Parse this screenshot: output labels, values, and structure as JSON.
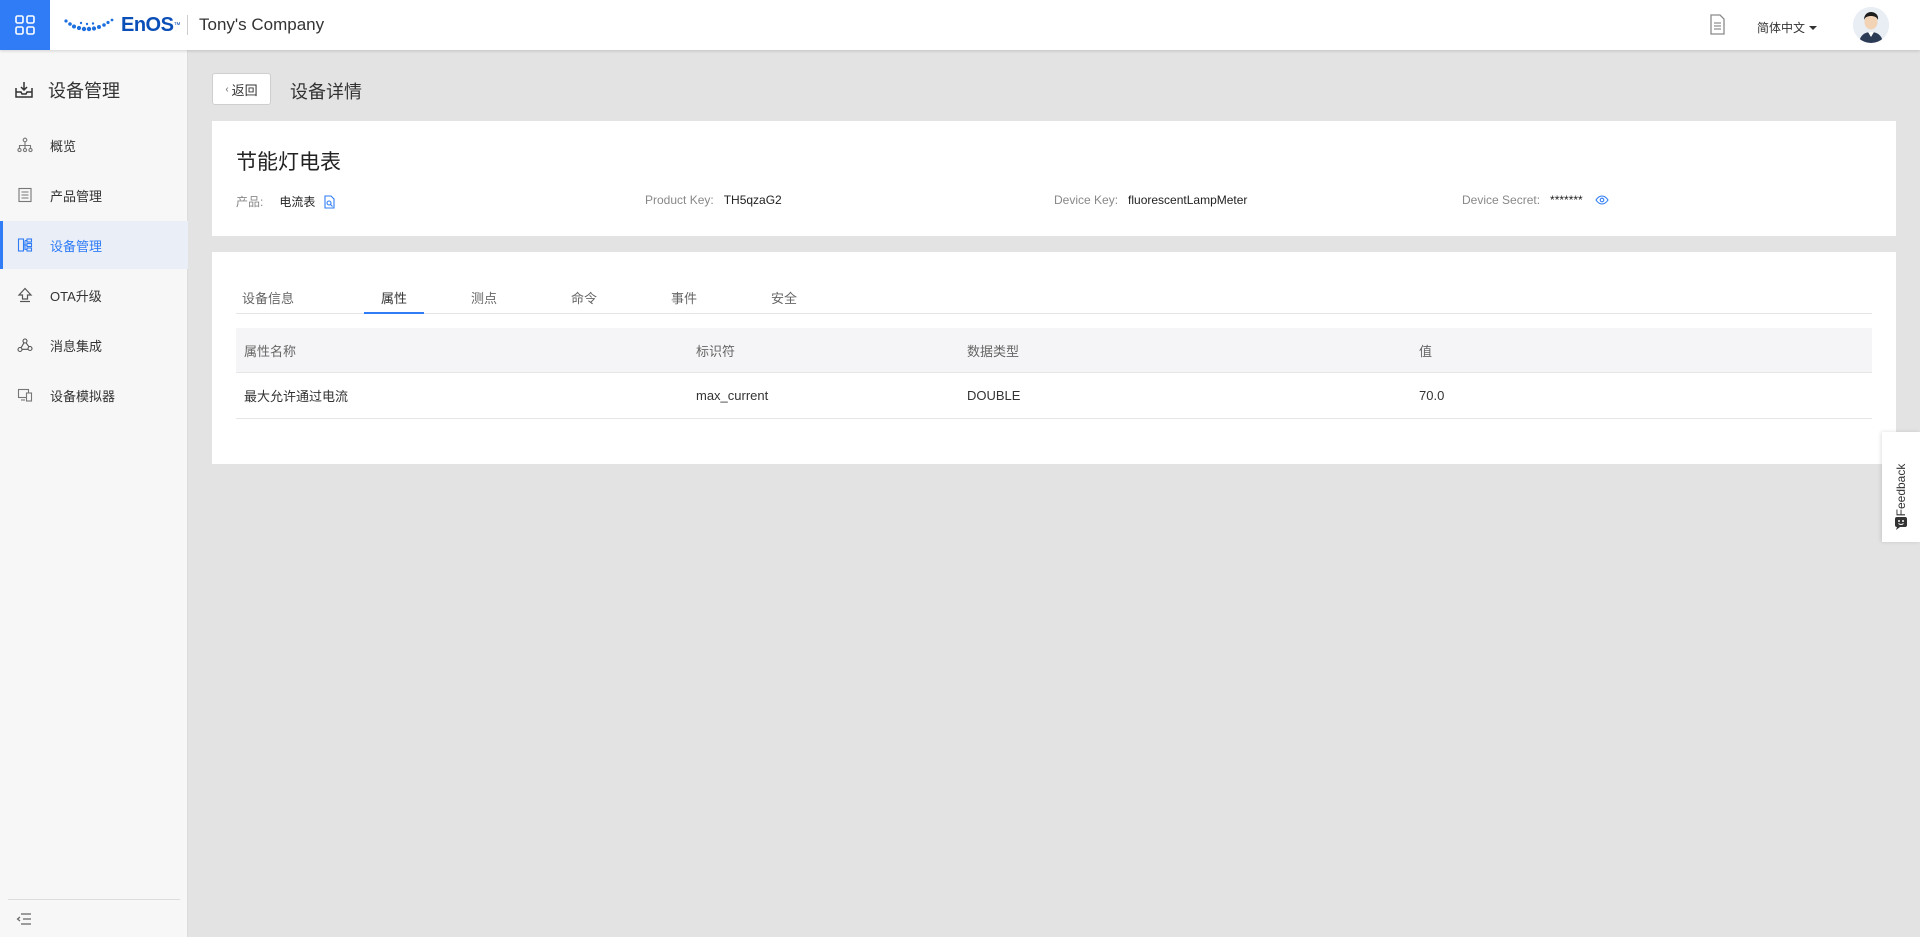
{
  "header": {
    "logo_brand": "EnOS",
    "company": "Tony's Company",
    "language": "简体中文",
    "icons": {
      "launcher": "app-grid-icon",
      "docs": "document-icon",
      "avatar": "user-avatar"
    }
  },
  "sidebar": {
    "title": "设备管理",
    "items": [
      {
        "label": "概览",
        "icon": "hierarchy-icon",
        "active": false
      },
      {
        "label": "产品管理",
        "icon": "product-list-icon",
        "active": false
      },
      {
        "label": "设备管理",
        "icon": "device-tree-icon",
        "active": true
      },
      {
        "label": "OTA升级",
        "icon": "upload-arrow-icon",
        "active": false
      },
      {
        "label": "消息集成",
        "icon": "share-nodes-icon",
        "active": false
      },
      {
        "label": "设备模拟器",
        "icon": "device-simulator-icon",
        "active": false
      }
    ],
    "collapse_icon": "collapse-menu-icon"
  },
  "page": {
    "back_label": "返回",
    "title": "设备详情"
  },
  "device": {
    "name": "节能灯电表",
    "product_label": "产品:",
    "product_value": "电流表",
    "product_key_label": "Product Key:",
    "product_key_value": "TH5qzaG2",
    "device_key_label": "Device Key:",
    "device_key_value": "fluorescentLampMeter",
    "device_secret_label": "Device Secret:",
    "device_secret_value": "*******"
  },
  "tabs": [
    {
      "label": "设备信息",
      "active": false
    },
    {
      "label": "属性",
      "active": true
    },
    {
      "label": "测点",
      "active": false
    },
    {
      "label": "命令",
      "active": false
    },
    {
      "label": "事件",
      "active": false
    },
    {
      "label": "安全",
      "active": false
    }
  ],
  "table": {
    "columns": [
      "属性名称",
      "标识符",
      "数据类型",
      "值"
    ],
    "rows": [
      [
        "最大允许通过电流",
        "max_current",
        "DOUBLE",
        "70.0"
      ]
    ]
  },
  "feedback": {
    "label": "Feedback"
  },
  "colors": {
    "accent": "#2f7cf6",
    "brand": "#0a4fb8",
    "background": "#e3e3e3"
  }
}
